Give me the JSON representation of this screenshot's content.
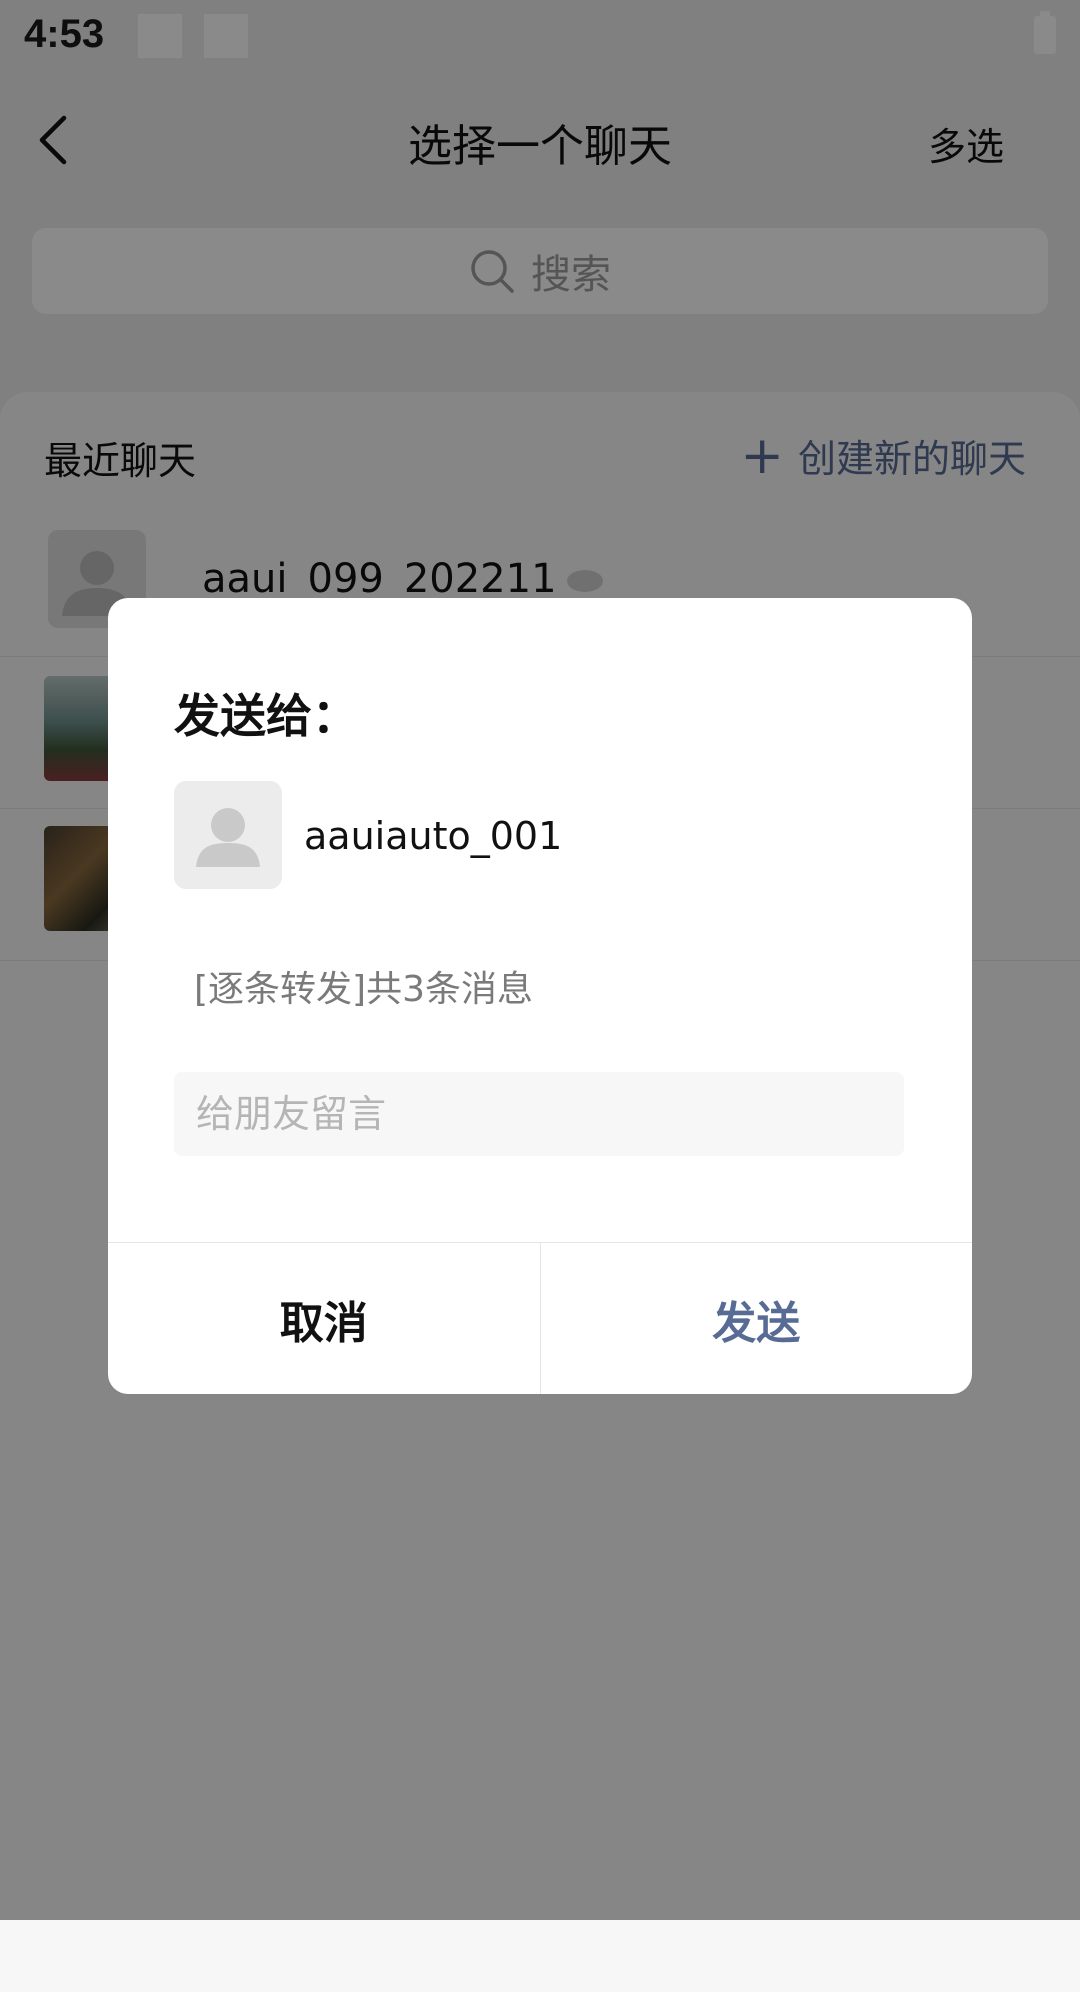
{
  "status_bar": {
    "time": "4:53"
  },
  "header": {
    "title": "选择一个聊天",
    "multi_select_label": "多选"
  },
  "search": {
    "placeholder": "搜索"
  },
  "recent": {
    "title": "最近聊天",
    "new_chat_label": "创建新的聊天",
    "chats": [
      {
        "name": "aaui_099_202211"
      }
    ]
  },
  "dialog": {
    "title": "发送给：",
    "recipient_name": "aauiauto_001",
    "forward_summary": "[逐条转发]共3条消息",
    "message_placeholder": "给朋友留言",
    "cancel_label": "取消",
    "send_label": "发送"
  },
  "colors": {
    "accent": "#576b95",
    "overlay": "rgba(0,0,0,0.46)"
  }
}
